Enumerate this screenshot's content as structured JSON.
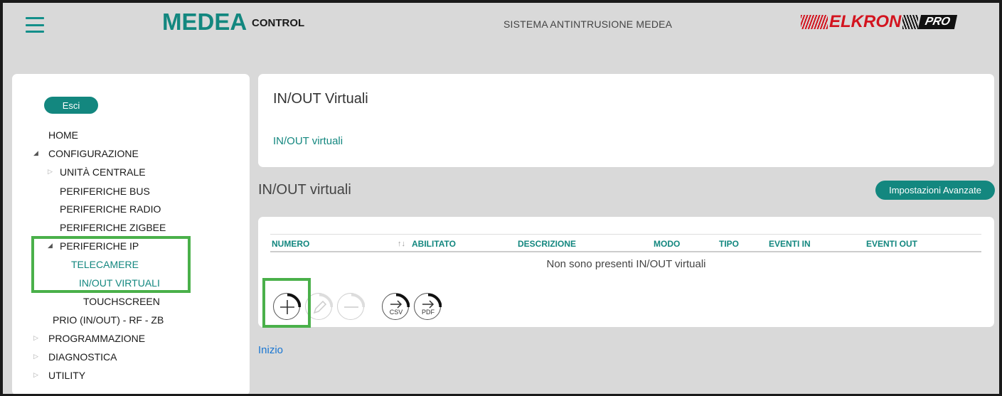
{
  "header": {
    "logo_main": "MEDEA",
    "logo_sub": "CONTROL",
    "system_title": "SISTEMA ANTINTRUSIONE MEDEA",
    "brand_logo": "ELKRON",
    "brand_suffix": "PRO",
    "accent_color": "#13877f",
    "brand_color": "#d3141f"
  },
  "sidebar": {
    "exit_label": "Esci",
    "items": [
      {
        "label": "HOME"
      },
      {
        "label": "CONFIGURAZIONE"
      },
      {
        "label": "UNITÀ CENTRALE"
      },
      {
        "label": "PERIFERICHE BUS"
      },
      {
        "label": "PERIFERICHE RADIO"
      },
      {
        "label": "PERIFERICHE ZIGBEE"
      },
      {
        "label": "PERIFERICHE IP"
      },
      {
        "label": "TELECAMERE"
      },
      {
        "label": "IN/OUT VIRTUALI"
      },
      {
        "label": "TOUCHSCREEN"
      },
      {
        "label": "PRIO (IN/OUT) - RF - ZB"
      },
      {
        "label": "PROGRAMMAZIONE"
      },
      {
        "label": "DIAGNOSTICA"
      },
      {
        "label": "UTILITY"
      }
    ]
  },
  "main": {
    "panel_title": "IN/OUT Virtuali",
    "panel_link": "IN/OUT virtuali",
    "section_title": "IN/OUT virtuali",
    "advanced_button": "Impostazioni Avanzate",
    "table": {
      "columns": [
        "NUMERO",
        "ABILITATO",
        "DESCRIZIONE",
        "MODO",
        "TIPO",
        "EVENTI IN",
        "EVENTI OUT"
      ],
      "sort_indicator": "↑↓",
      "empty_message": "Non sono presenti IN/OUT virtuali"
    },
    "actions": [
      {
        "icon": "add-icon",
        "enabled": true
      },
      {
        "icon": "edit-icon",
        "enabled": false
      },
      {
        "icon": "remove-icon",
        "enabled": false
      },
      {
        "icon": "export-csv-icon",
        "label": "CSV",
        "enabled": true
      },
      {
        "icon": "export-pdf-icon",
        "label": "PDF",
        "enabled": true
      }
    ],
    "home_link": "Inizio"
  }
}
